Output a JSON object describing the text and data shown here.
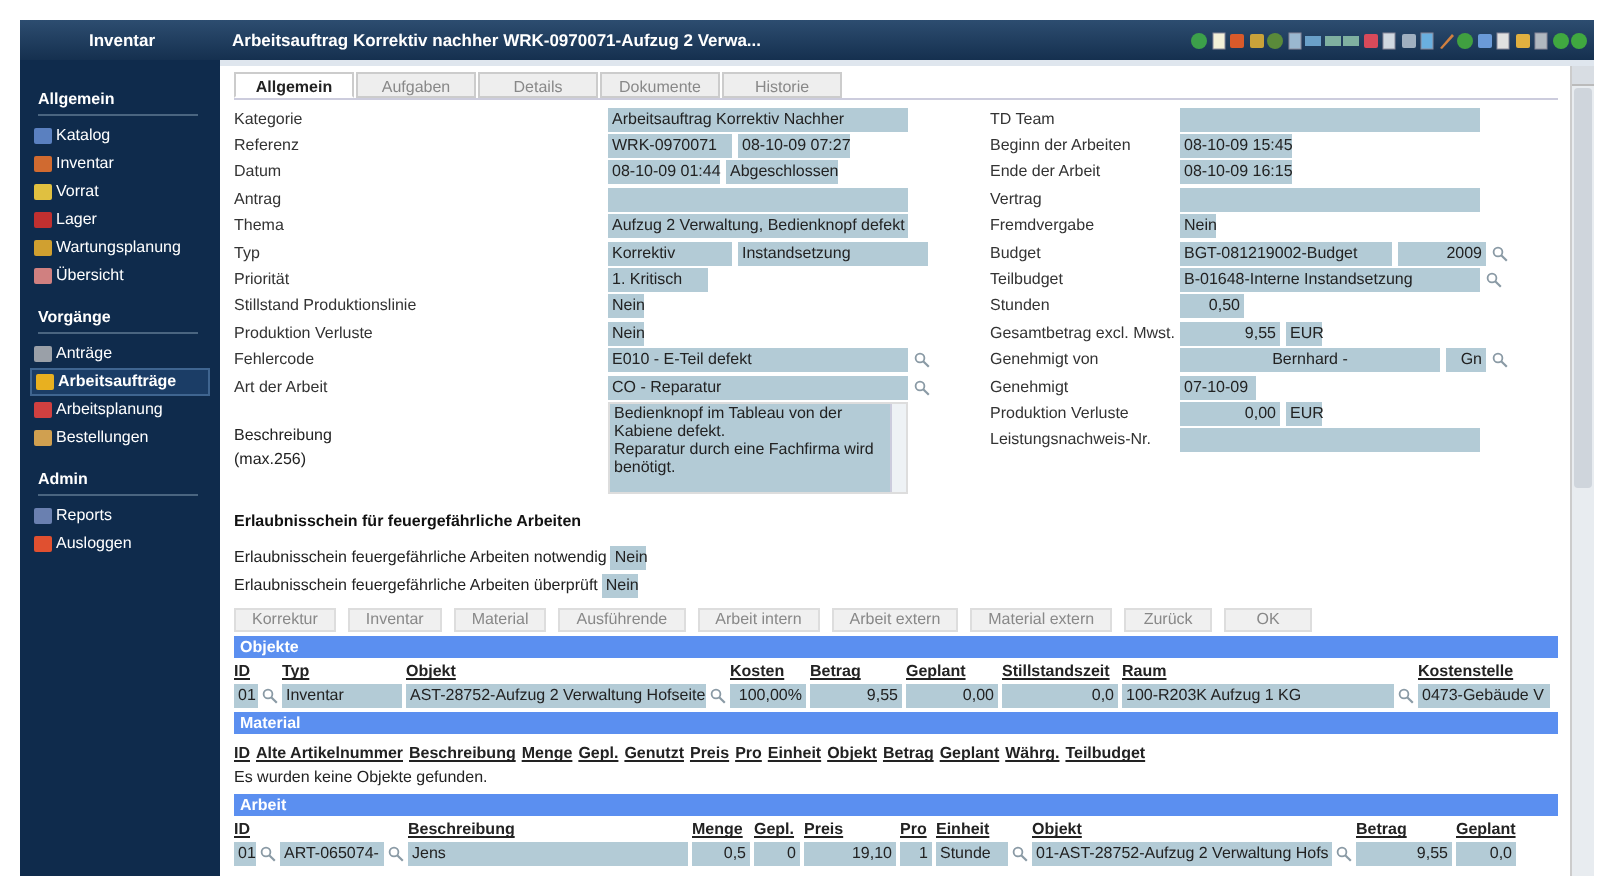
{
  "header": {
    "app_title": "Inventar",
    "window_title": "Arbeitsauftrag Korrektiv nachher WRK-0970071-Aufzug 2 Verwa..."
  },
  "sidebar": {
    "sections": [
      {
        "title": "Allgemein",
        "items": [
          {
            "label": "Katalog",
            "selected": false
          },
          {
            "label": "Inventar",
            "selected": false
          },
          {
            "label": "Vorrat",
            "selected": false
          },
          {
            "label": "Lager",
            "selected": false
          },
          {
            "label": "Wartungsplanung",
            "selected": false
          },
          {
            "label": "Übersicht",
            "selected": false
          }
        ]
      },
      {
        "title": "Vorgänge",
        "items": [
          {
            "label": "Anträge",
            "selected": false
          },
          {
            "label": "Arbeitsaufträge",
            "selected": true
          },
          {
            "label": "Arbeitsplanung",
            "selected": false
          },
          {
            "label": "Bestellungen",
            "selected": false
          }
        ]
      },
      {
        "title": "Admin",
        "items": [
          {
            "label": "Reports",
            "selected": false
          },
          {
            "label": "Ausloggen",
            "selected": false
          }
        ]
      }
    ]
  },
  "tabs": [
    {
      "label": "Allgemein",
      "selected": true
    },
    {
      "label": "Aufgaben",
      "selected": false
    },
    {
      "label": "Details",
      "selected": false
    },
    {
      "label": "Dokumente",
      "selected": false
    },
    {
      "label": "Historie",
      "selected": false
    }
  ],
  "form_left": [
    {
      "label": "Kategorie",
      "fields": [
        {
          "text": "Arbeitsauftrag Korrektiv Nachher",
          "kind": "full"
        }
      ]
    },
    {
      "label": "Referenz",
      "fields": [
        {
          "text": "WRK-0970071",
          "kind": "ref"
        },
        {
          "text": "08-10-09 07:27",
          "kind": "stamp"
        }
      ]
    },
    {
      "label": "Datum",
      "fields": [
        {
          "text": "08-10-09 01:44",
          "kind": "stamp"
        },
        {
          "text": "Abgeschlossen",
          "kind": "stamp"
        }
      ]
    },
    {
      "label": "Antrag",
      "fields": [
        {
          "kind": "full"
        }
      ]
    },
    {
      "label": "Thema",
      "fields": [
        {
          "text": "Aufzug 2 Verwaltung, Bedienknopf defekt",
          "kind": "full"
        }
      ]
    },
    {
      "label": "Typ",
      "fields": [
        {
          "text": "Korrektiv",
          "kind": "ref"
        },
        {
          "text": "Instandsetzung",
          "kind": "type"
        }
      ]
    },
    {
      "label": "Priorität",
      "fields": [
        {
          "text": "1. Kritisch",
          "kind": "prio"
        }
      ]
    },
    {
      "label": "Stillstand Produktionslinie",
      "fields": [
        {
          "text": "Nein",
          "kind": "yesno"
        }
      ]
    },
    {
      "label": "Produktion Verluste",
      "fields": [
        {
          "text": "Nein",
          "kind": "yesno"
        }
      ]
    },
    {
      "label": "Fehlercode",
      "fields": [
        {
          "text": "E010 - E-Teil defekt",
          "kind": "full"
        }
      ],
      "lookup": true
    },
    {
      "label": "Art der Arbeit",
      "fields": [
        {
          "text": "CO - Reparatur",
          "kind": "full"
        }
      ],
      "lookup": true
    }
  ],
  "description": {
    "label": "Beschreibung",
    "hint": "(max.256)",
    "value": "Bedienknopf im Tableau von der Kabiene defekt.\nReparatur durch eine Fachfirma wird benötigt."
  },
  "form_right": [
    {
      "label": "TD Team",
      "fields": [
        {
          "kind": "full"
        }
      ]
    },
    {
      "label": "Beginn der Arbeiten",
      "fields": [
        {
          "text": "08-10-09 15:45",
          "kind": "stamp"
        }
      ]
    },
    {
      "label": "Ende der Arbeit",
      "fields": [
        {
          "text": "08-10-09 16:15",
          "kind": "stamp"
        }
      ]
    },
    {
      "label": "Vertrag",
      "fields": [
        {
          "kind": "full"
        }
      ]
    },
    {
      "label": "Fremdvergabe",
      "fields": [
        {
          "text": "Nein",
          "kind": "yesno"
        }
      ]
    },
    {
      "label": "Budget",
      "fields": [
        {
          "text": "BGT-081219002-Budget",
          "kind": "budget"
        },
        {
          "text": "2009",
          "kind": "year"
        }
      ],
      "lookup": true
    },
    {
      "label": "Teilbudget",
      "fields": [
        {
          "text": "B-01648-Interne Instandsetzung",
          "kind": "full"
        }
      ],
      "lookup": true
    },
    {
      "label": "Stunden",
      "fields": [
        {
          "text": "0,50",
          "kind": "hours"
        }
      ]
    },
    {
      "label": "Gesamtbetrag excl. Mwst.",
      "fields": [
        {
          "text": "9,55",
          "kind": "amount"
        },
        {
          "text": "EUR",
          "kind": "unit"
        }
      ]
    },
    {
      "label": "Genehmigt von",
      "fields": [
        {
          "text": "Bernhard -",
          "kind": "name"
        },
        {
          "text": "Gn",
          "kind": "tail"
        }
      ],
      "lookup": true
    },
    {
      "label": "Genehmigt",
      "fields": [
        {
          "text": "07-10-09",
          "kind": "short"
        }
      ]
    },
    {
      "label": "Produktion Verluste",
      "fields": [
        {
          "text": "0,00",
          "kind": "amount"
        },
        {
          "text": "EUR",
          "kind": "unit"
        }
      ]
    },
    {
      "label": "Leistungsnachweis-Nr.",
      "fields": [
        {
          "kind": "full"
        }
      ]
    }
  ],
  "permit": {
    "title": "Erlaubnisschein für feuergefährliche Arbeiten",
    "rows": [
      {
        "label": "Erlaubnisschein feuergefährliche Arbeiten notwendig",
        "value": "Nein"
      },
      {
        "label": "Erlaubnisschein feuergefährliche Arbeiten überprüft",
        "value": "Nein"
      }
    ]
  },
  "buttons": [
    "Korrektur",
    "Inventar",
    "Material",
    "Ausführende",
    "Arbeit intern",
    "Arbeit extern",
    "Material extern",
    "Zurück",
    "OK"
  ],
  "objekte": {
    "title": "Objekte",
    "columns": [
      "ID",
      "Typ",
      "Objekt",
      "Kosten",
      "Betrag",
      "Geplant",
      "Stillstandszeit",
      "Raum",
      "Kostenstelle"
    ],
    "row": [
      "01",
      "Inventar",
      "AST-28752-Aufzug 2 Verwaltung Hofseite",
      "100,00%",
      "9,55",
      "0,00",
      "0,0",
      "100-R203K Aufzug 1  KG",
      "0473-Gebäude V"
    ]
  },
  "material": {
    "title": "Material",
    "columns": [
      "ID",
      "Alte Artikelnummer",
      "Beschreibung",
      "Menge",
      "Gepl.",
      "Genutzt",
      "Preis",
      "Pro",
      "Einheit",
      "Objekt",
      "Betrag",
      "Geplant",
      "Währg.",
      "Teilbudget"
    ],
    "message": "Es wurden keine Objekte gefunden."
  },
  "arbeit": {
    "title": "Arbeit",
    "columns": [
      "ID",
      "",
      "Beschreibung",
      "Menge",
      "Gepl.",
      "Preis",
      "Pro",
      "Einheit",
      "Objekt",
      "Betrag",
      "Geplant"
    ],
    "row": [
      "01",
      "ART-065074-",
      "Jens",
      "0,5",
      "0",
      "19,10",
      "1",
      "Stunde",
      "01-AST-28752-Aufzug 2 Verwaltung Hofs",
      "9,55",
      "0,0"
    ]
  }
}
